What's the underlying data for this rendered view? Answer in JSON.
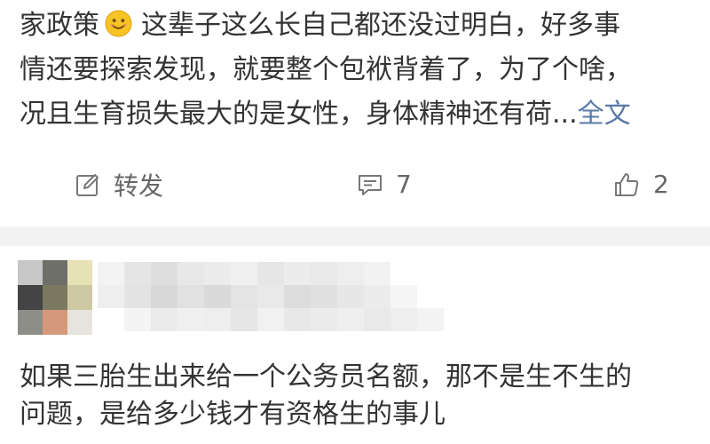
{
  "post": {
    "line1_before_emoji": "家政策",
    "emoji": "smile-emoji",
    "line1_after_emoji": "这辈子这么长自己都还没过明白，好多事",
    "line2": "情还要探索发现，就要整个包袱背着了，为了个啥，",
    "line3": "况且生育损失最大的是女性，身体精神还有荷...",
    "more_label": "全文"
  },
  "actions": {
    "repost_label": "转发",
    "comment_count": "7",
    "like_count": "2"
  },
  "comment": {
    "author_blurred": true,
    "line1": "如果三胎生出来给一个公务员名额，那不是生不生的",
    "line2": "问题，是给多少钱才有资格生的事儿"
  },
  "colors": {
    "link": "#5a7aa6",
    "icon": "#666666",
    "background": "#f2f2f2"
  }
}
